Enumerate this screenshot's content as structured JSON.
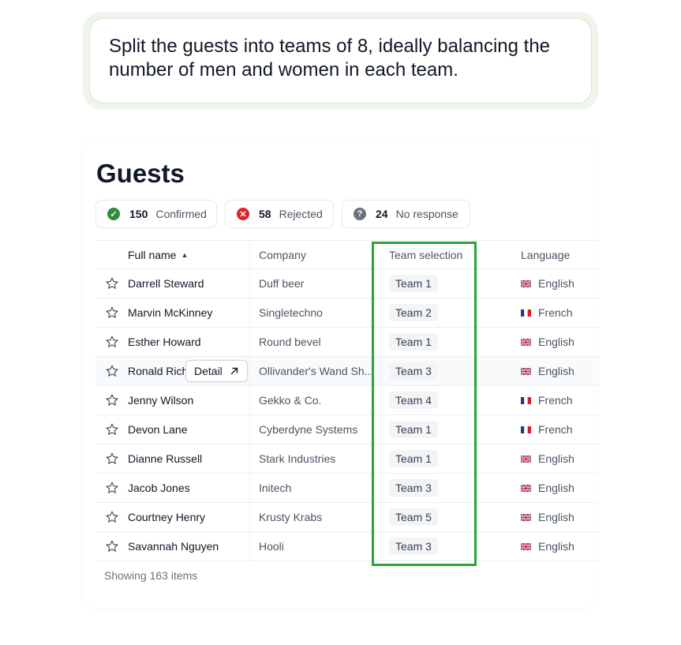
{
  "prompt": "Split the guests into teams of 8, ideally balancing the number of men and women in each team.",
  "title": "Guests",
  "stats": [
    {
      "icon": "check-icon",
      "count": "150",
      "label": "Confirmed",
      "color": "#2f8a3e"
    },
    {
      "icon": "x-icon",
      "count": "58",
      "label": "Rejected",
      "color": "#dc2626"
    },
    {
      "icon": "question-icon",
      "count": "24",
      "label": "No response",
      "color": "#6b7280"
    }
  ],
  "columns": {
    "name": "Full name",
    "company": "Company",
    "team": "Team selection",
    "language": "Language"
  },
  "rows": [
    {
      "name": "Darrell Steward",
      "company": "Duff beer",
      "team": "Team 1",
      "language": "English",
      "flag": "uk"
    },
    {
      "name": "Marvin McKinney",
      "company": "Singletechno",
      "team": "Team 2",
      "language": "French",
      "flag": "fr"
    },
    {
      "name": "Esther Howard",
      "company": "Round bevel",
      "team": "Team 1",
      "language": "English",
      "flag": "uk"
    },
    {
      "name": "Ronald Rich",
      "company": "Ollivander's Wand Sh...",
      "team": "Team 3",
      "language": "English",
      "flag": "uk"
    },
    {
      "name": "Jenny Wilson",
      "company": "Gekko & Co.",
      "team": "Team 4",
      "language": "French",
      "flag": "fr"
    },
    {
      "name": "Devon Lane",
      "company": "Cyberdyne Systems",
      "team": "Team 1",
      "language": "French",
      "flag": "fr"
    },
    {
      "name": "Dianne Russell",
      "company": "Stark Industries",
      "team": "Team 1",
      "language": "English",
      "flag": "uk"
    },
    {
      "name": "Jacob Jones",
      "company": "Initech",
      "team": "Team 3",
      "language": "English",
      "flag": "uk"
    },
    {
      "name": "Courtney Henry",
      "company": "Krusty Krabs",
      "team": "Team 5",
      "language": "English",
      "flag": "uk"
    },
    {
      "name": "Savannah Nguyen",
      "company": "Hooli",
      "team": "Team 3",
      "language": "English",
      "flag": "uk"
    }
  ],
  "detail_label": "Detail",
  "footer": "Showing 163 items",
  "highlight_color": "#2aa53b"
}
